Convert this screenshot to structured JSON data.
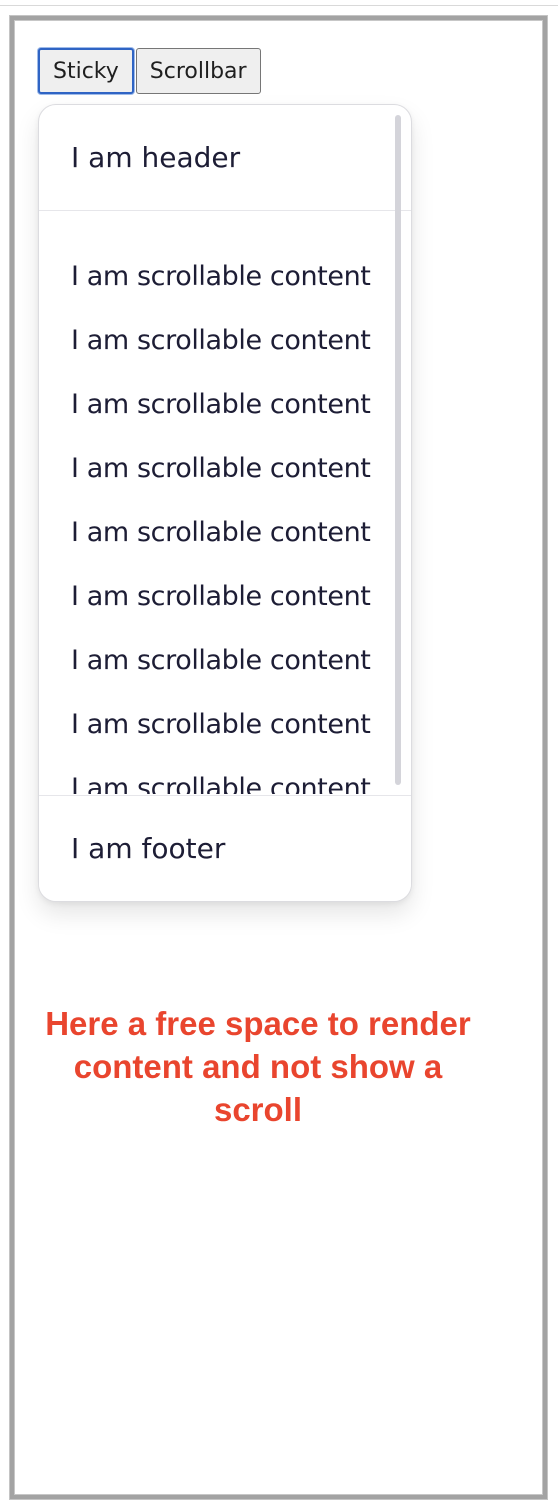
{
  "toolbar": {
    "buttons": [
      {
        "label": "Sticky",
        "active": true
      },
      {
        "label": "Scrollbar",
        "active": false
      }
    ]
  },
  "panel": {
    "header": "I am header",
    "items": [
      "I am scrollable content",
      "I am scrollable content",
      "I am scrollable content",
      "I am scrollable content",
      "I am scrollable content",
      "I am scrollable content",
      "I am scrollable content",
      "I am scrollable content",
      "I am scrollable content"
    ],
    "footer": "I am footer"
  },
  "note": "Here a free space to render content and not show a scroll",
  "colors": {
    "note": "#e9452e",
    "text": "#1d1d35",
    "active_border": "#2f64c4"
  }
}
